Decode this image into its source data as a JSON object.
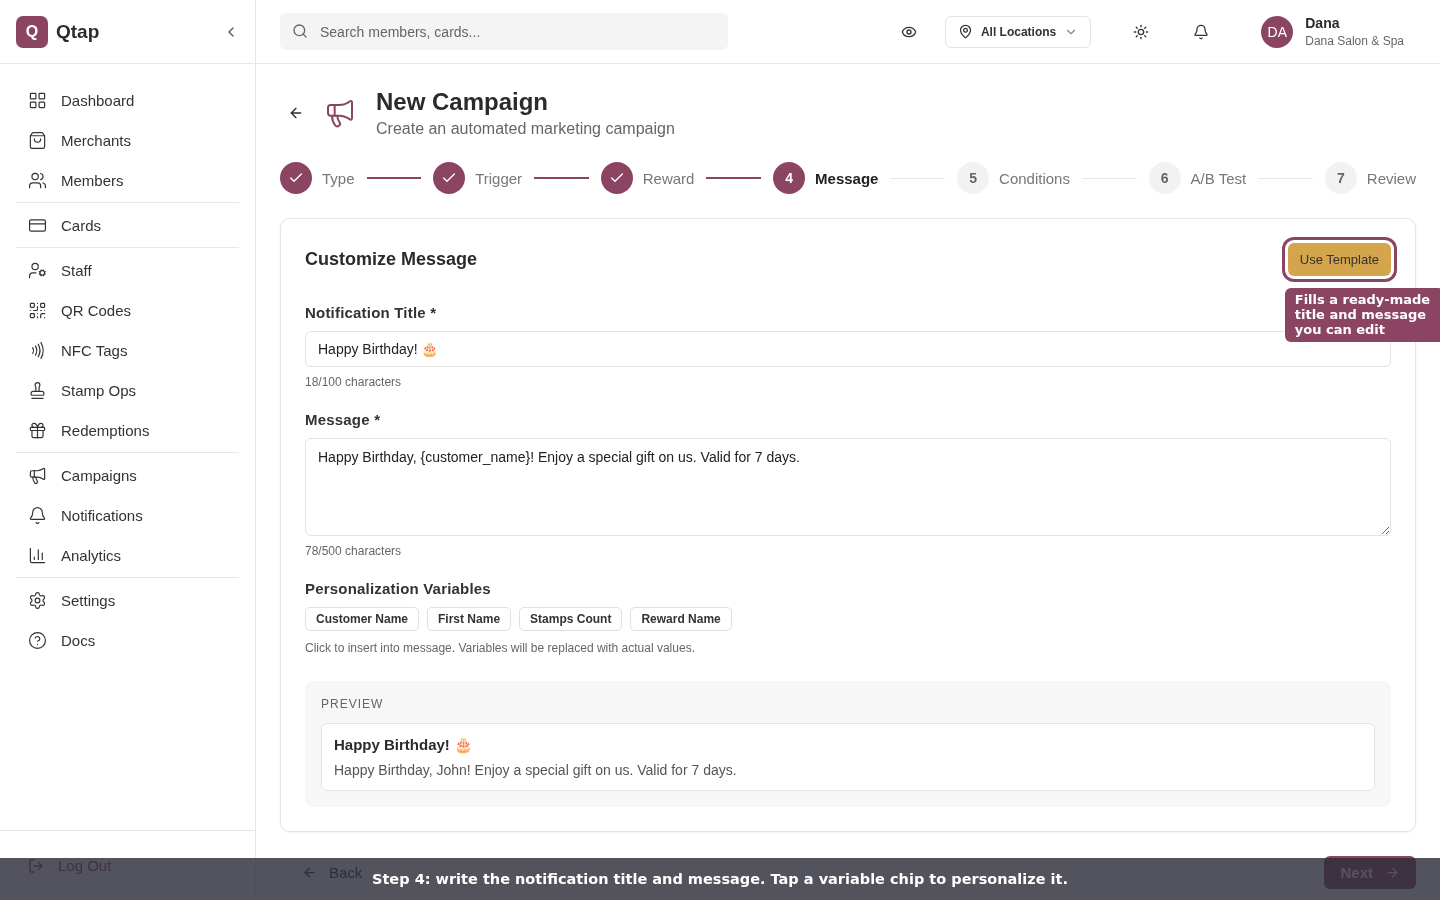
{
  "brand": {
    "logo": "Q",
    "name": "Qtap"
  },
  "sidebar": {
    "groups": [
      [
        {
          "label": "Dashboard",
          "selected": false
        },
        {
          "label": "Merchants",
          "selected": false
        },
        {
          "label": "Members",
          "selected": false
        }
      ],
      [
        {
          "label": "Cards",
          "selected": false
        }
      ],
      [
        {
          "label": "Staff",
          "selected": false
        },
        {
          "label": "QR Codes",
          "selected": false
        },
        {
          "label": "NFC Tags",
          "selected": false
        },
        {
          "label": "Stamp Ops",
          "selected": false
        },
        {
          "label": "Redemptions",
          "selected": false
        }
      ],
      [
        {
          "label": "Campaigns",
          "selected": false
        },
        {
          "label": "Notifications",
          "selected": false
        },
        {
          "label": "Analytics",
          "selected": false
        }
      ],
      [
        {
          "label": "Settings",
          "selected": false
        },
        {
          "label": "Docs",
          "selected": false
        }
      ]
    ],
    "logout": "Log Out"
  },
  "topbar": {
    "search": {
      "placeholder": "Search members, cards..."
    },
    "location": "All Locations",
    "user": {
      "initials": "DA",
      "name": "Dana",
      "business": "Dana Salon & Spa"
    }
  },
  "page": {
    "title": "New Campaign",
    "subtitle": "Create an automated marketing campaign"
  },
  "steps": [
    {
      "label": "Type",
      "done": true,
      "selected": false
    },
    {
      "label": "Trigger",
      "done": true,
      "selected": false
    },
    {
      "label": "Reward",
      "done": true,
      "selected": false
    },
    {
      "number": "4",
      "label": "Message",
      "done": false,
      "selected": true
    },
    {
      "number": "5",
      "label": "Conditions",
      "done": false,
      "selected": false
    },
    {
      "number": "6",
      "label": "A/B Test",
      "done": false,
      "selected": false
    },
    {
      "number": "7",
      "label": "Review",
      "done": false,
      "selected": false
    }
  ],
  "card": {
    "title": "Customize Message",
    "template_button": "Use Template",
    "tooltip": "Fills a ready-made title and message you can edit",
    "title_field": {
      "label": "Notification Title *",
      "value": "Happy Birthday! 🎂",
      "count": "18/100 characters"
    },
    "message_field": {
      "label": "Message *",
      "value": "Happy Birthday, {customer_name}! Enjoy a special gift on us. Valid for 7 days.",
      "count": "78/500 characters"
    },
    "variables": {
      "label": "Personalization Variables",
      "chips": [
        "Customer Name",
        "First Name",
        "Stamps Count",
        "Reward Name"
      ],
      "hint": "Click to insert into message. Variables will be replaced with actual values."
    },
    "preview": {
      "label": "PREVIEW",
      "title": "Happy Birthday! 🎂",
      "body": "Happy Birthday, John! Enjoy a special gift on us. Valid for 7 days."
    }
  },
  "footer": {
    "back": "Back",
    "next": "Next"
  },
  "banner": "Step 4: write the notification title and message. Tap a variable chip to personalize it."
}
